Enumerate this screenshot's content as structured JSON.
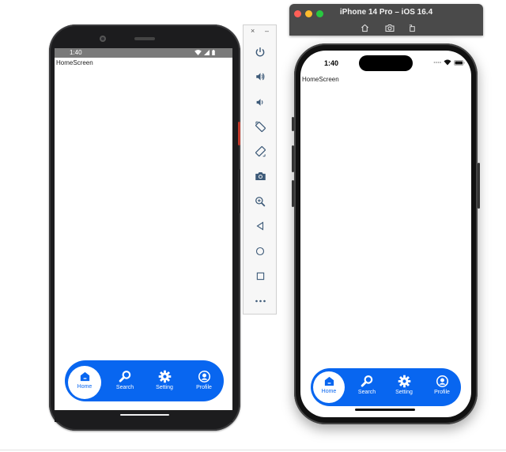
{
  "android": {
    "status_time": "1:40",
    "screen_label": "HomeScreen"
  },
  "ios": {
    "window_title": "iPhone 14 Pro – iOS 16.4",
    "status_time": "1:40",
    "screen_label": "HomeScreen"
  },
  "nav": {
    "items": [
      {
        "label": "Home",
        "icon": "home-icon",
        "active": true
      },
      {
        "label": "Search",
        "icon": "search-icon",
        "active": false
      },
      {
        "label": "Setting",
        "icon": "gear-icon",
        "active": false
      },
      {
        "label": "Profile",
        "icon": "profile-icon",
        "active": false
      }
    ]
  },
  "emulator_toolbar": {
    "close_glyph": "×",
    "minimize_glyph": "–",
    "buttons": [
      "power-icon",
      "volume-up-icon",
      "volume-down-icon",
      "rotate-left-icon",
      "rotate-right-icon",
      "camera-icon",
      "zoom-icon",
      "back-icon",
      "home-icon",
      "overview-icon",
      "more-icon"
    ]
  },
  "colors": {
    "nav_blue": "#0866f0",
    "traffic_red": "#ff5f57",
    "traffic_yellow": "#febc2e",
    "traffic_green": "#28c840"
  }
}
